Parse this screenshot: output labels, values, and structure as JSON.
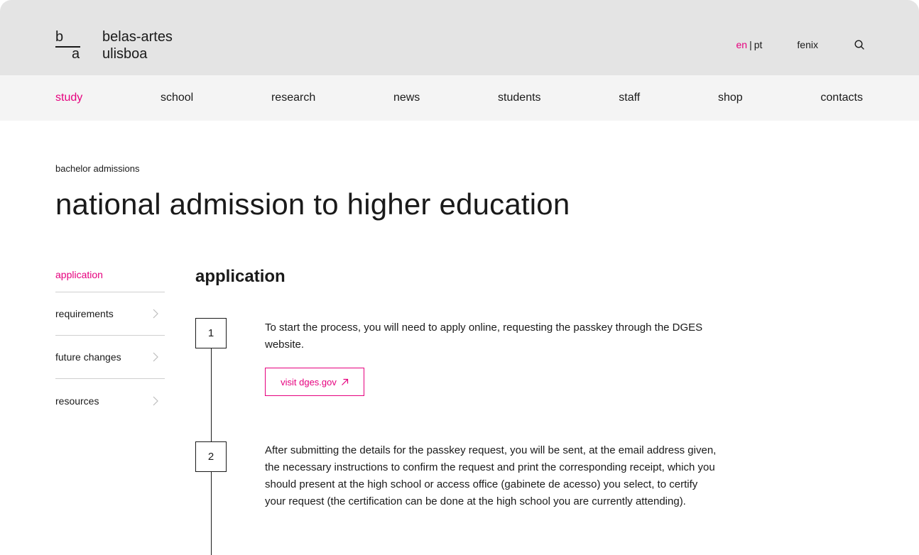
{
  "brand": {
    "mark_top": "b",
    "mark_bottom": "a",
    "name_line1": "belas-artes",
    "name_line2": "ulisboa"
  },
  "topbar": {
    "lang_active": "en",
    "lang_separator": "|",
    "lang_other": "pt",
    "fenix_label": "fenix",
    "search_icon": "search-icon"
  },
  "nav": {
    "items": [
      "study",
      "school",
      "research",
      "news",
      "students",
      "staff",
      "shop",
      "contacts"
    ],
    "active": "study"
  },
  "breadcrumb": "bachelor admissions",
  "page_title": "national admission to higher education",
  "sidenav": {
    "items": [
      "application",
      "requirements",
      "future changes",
      "resources"
    ],
    "active": "application"
  },
  "section_title": "application",
  "steps": [
    {
      "number": "1",
      "text": "To start the process, you will need to apply online, requesting the passkey through the DGES website.",
      "button_label": "visit dges.gov",
      "button_icon": "external-link-arrow-icon"
    },
    {
      "number": "2",
      "text": "After submitting the details for the passkey request, you will be sent, at the email address given, the necessary instructions to confirm the request and print the corresponding receipt, which you should present at the high school or access office (gabinete de acesso) you select, to certify your request (the certification can be done at the high school you are currently attending)."
    }
  ],
  "colors": {
    "accent": "#e6007e",
    "topbar_bg": "#e4e4e4",
    "nav_bg": "#f4f4f4",
    "text": "#1a1a1a"
  }
}
